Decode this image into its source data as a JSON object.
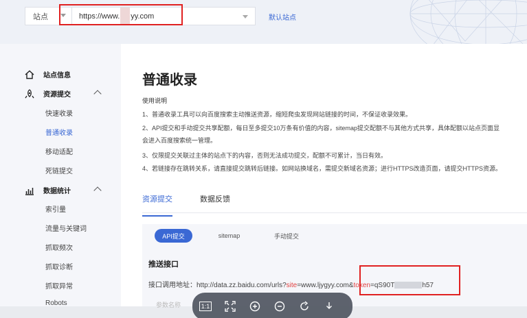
{
  "topbar": {
    "site_label": "站点",
    "url_prefix": "https://www.",
    "url_suffix": "yy.com",
    "default_site": "默认站点"
  },
  "sidebar": {
    "groups": [
      {
        "label": "站点信息",
        "icon": "home-icon"
      },
      {
        "label": "资源提交",
        "icon": "submit-icon"
      },
      {
        "label": "数据统计",
        "icon": "chart-icon"
      }
    ],
    "items": [
      {
        "label": "快速收录"
      },
      {
        "label": "普通收录"
      },
      {
        "label": "移动适配"
      },
      {
        "label": "死链提交"
      },
      {
        "label": "索引量"
      },
      {
        "label": "流量与关键词"
      },
      {
        "label": "抓取频次"
      },
      {
        "label": "抓取诊断"
      },
      {
        "label": "抓取异常"
      },
      {
        "label": "Robots"
      }
    ]
  },
  "main": {
    "title": "普通收录",
    "usage_title": "使用说明",
    "usage_lines": [
      "1、普通收录工具可以向百度搜索主动推送资源，缩短爬虫发现网站链接的时间，不保证收录效果。",
      "2、API提交和手动提交共享配额，每日至多提交10万条有价值的内容，sitemap提交配额不与其他方式共享，具体配额以站点页面显",
      "会进入百度搜索统一管理。",
      "3、仅限提交关联过主体的站点下的内容，否则无法成功提交，配额不可累计，当日有效。",
      "4、若链接存在跳转关系，请直接提交跳转后链接。如网站换域名，需提交新域名资源；进行HTTPS改造页面，请提交HTTPS资源。"
    ],
    "tabs": [
      {
        "label": "资源提交"
      },
      {
        "label": "数据反馈"
      }
    ],
    "pills": [
      {
        "label": "API提交"
      },
      {
        "label": "sitemap"
      },
      {
        "label": "手动提交"
      }
    ],
    "section_title": "推送接口",
    "api_label": "接口调用地址：",
    "api_url_a": "http://data.zz.baidu.com/urls?",
    "api_param_site": "site",
    "api_url_b": "=www.ljygyy.com&",
    "api_param_token": "token",
    "api_url_c": "=qS90T",
    "api_url_d": "h57",
    "faint_text": "参数名称"
  },
  "viewer": {
    "actual_size": "1:1"
  },
  "colors": {
    "accent": "#3a68d4",
    "highlight_box": "#e02020"
  }
}
